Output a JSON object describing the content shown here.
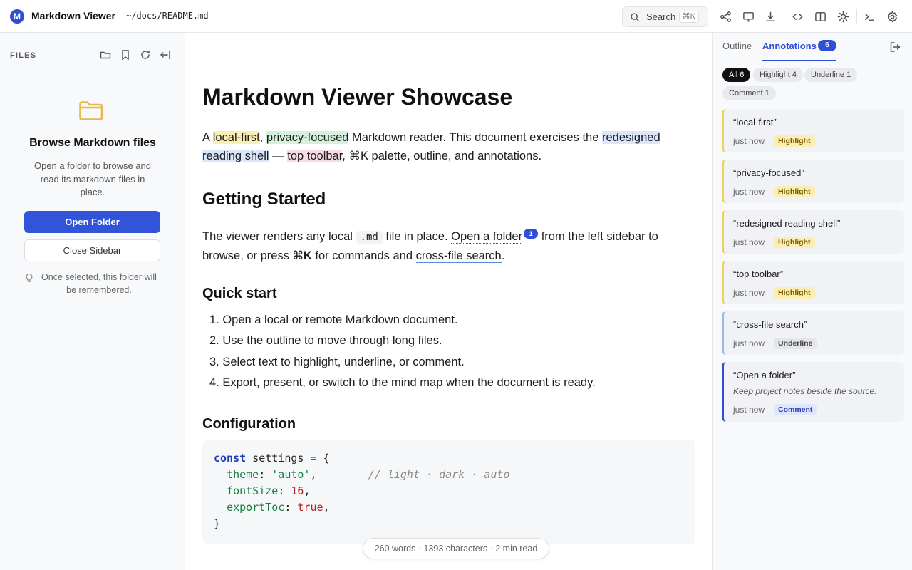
{
  "app": {
    "name": "Markdown Viewer",
    "logo_letter": "M",
    "doc_path": "~/docs/README.md"
  },
  "toolbar": {
    "search_label": "Search",
    "search_shortcut": "⌘K",
    "icons": [
      "mind-map-icon",
      "present-icon",
      "download-icon",
      "code-icon",
      "split-view-icon",
      "theme-icon",
      "terminal-icon",
      "settings-icon"
    ]
  },
  "sidebar": {
    "section_label": "FILES",
    "empty_title": "Browse Markdown files",
    "empty_desc": "Open a folder to browse and read its markdown files in place.",
    "open_button": "Open Folder",
    "close_button": "Close Sidebar",
    "hint": "Once selected, this folder will be remembered."
  },
  "document": {
    "title": "Markdown Viewer Showcase",
    "intro": {
      "p1": "A ",
      "hl1": "local-first",
      "p2": ", ",
      "hl2": "privacy-focused",
      "p3": " Markdown reader. This document exercises the ",
      "hl3": "redesigned reading shell",
      "p4": " — ",
      "hl4": "top toolbar",
      "p5": ", ⌘K palette, outline, and annotations."
    },
    "getting_started": {
      "heading": "Getting Started",
      "p1": "The viewer renders any local ",
      "code": ".md",
      "p2": " file in place. ",
      "link": "Open a folder",
      "badge": "1",
      "p3": " from the left sidebar to browse, or press ",
      "kbd": "⌘K",
      "p4": " for commands and ",
      "link2": "cross-file search",
      "p5": "."
    },
    "quick_start": {
      "heading": "Quick start",
      "items": [
        "1. Open a local or remote Markdown document.",
        "2. Use the outline to move through long files.",
        "3. Select text to highlight, underline, or comment.",
        "4. Export, present, or switch to the mind map when the document is ready."
      ]
    },
    "configuration": {
      "heading": "Configuration",
      "code": {
        "kw": "const",
        "l1_rest": " settings = {",
        "theme_key": "theme",
        "theme_val": "'auto'",
        "theme_comment": "// light · dark · auto",
        "font_key": "fontSize",
        "font_val": "16",
        "toc_key": "exportToc",
        "toc_val": "true",
        "close": "}"
      }
    },
    "stats": "260 words · 1393 characters · 2 min read"
  },
  "right_panel": {
    "tab_outline": "Outline",
    "tab_annotations": "Annotations",
    "annotation_count": "6",
    "filters": [
      {
        "label": "All 6",
        "active": true
      },
      {
        "label": "Highlight 4",
        "active": false
      },
      {
        "label": "Underline 1",
        "active": false
      },
      {
        "label": "Comment 1",
        "active": false
      }
    ],
    "annotations": [
      {
        "quote": "“local-first”",
        "time": "just now",
        "type": "Highlight"
      },
      {
        "quote": "“privacy-focused”",
        "time": "just now",
        "type": "Highlight"
      },
      {
        "quote": "“redesigned reading shell”",
        "time": "just now",
        "type": "Highlight"
      },
      {
        "quote": "“top toolbar”",
        "time": "just now",
        "type": "Highlight"
      },
      {
        "quote": "“cross-file search”",
        "time": "just now",
        "type": "Underline"
      },
      {
        "quote": "“Open a folder”",
        "note": "Keep project notes beside the source.",
        "time": "just now",
        "type": "Comment"
      }
    ]
  },
  "colors": {
    "accent": "#2f4fd6",
    "highlight_yellow": "#fbeeb3",
    "highlight_green": "#d6f0dc",
    "highlight_blue": "#dbe6fb",
    "highlight_pink": "#f9dbe6",
    "folder_icon": "#e8b84a"
  }
}
